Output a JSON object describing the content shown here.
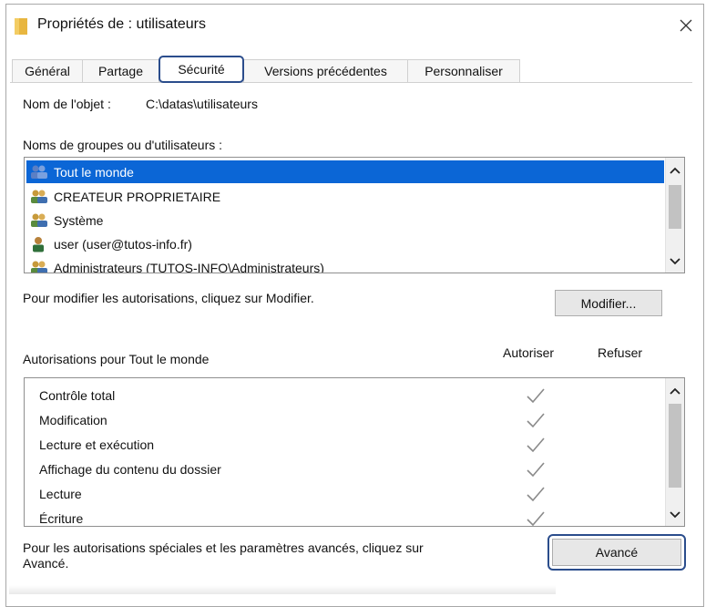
{
  "window": {
    "title": "Propriétés de : utilisateurs"
  },
  "tabs": [
    {
      "label": "Général"
    },
    {
      "label": "Partage"
    },
    {
      "label": "Sécurité"
    },
    {
      "label": "Versions précédentes"
    },
    {
      "label": "Personnaliser"
    }
  ],
  "object": {
    "label": "Nom de l'objet :",
    "value": "C:\\datas\\utilisateurs"
  },
  "groups": {
    "label": "Noms de groupes ou d'utilisateurs :",
    "items": [
      {
        "name": "Tout le monde",
        "selected": true,
        "icon": "group-icon"
      },
      {
        "name": "CREATEUR PROPRIETAIRE",
        "selected": false,
        "icon": "group-icon"
      },
      {
        "name": "Système",
        "selected": false,
        "icon": "group-icon"
      },
      {
        "name": "user (user@tutos-info.fr)",
        "selected": false,
        "icon": "user-icon"
      },
      {
        "name": "Administrateurs (TUTOS-INFO\\Administrateurs)",
        "selected": false,
        "icon": "group-icon"
      }
    ]
  },
  "modify": {
    "hint": "Pour modifier les autorisations, cliquez sur Modifier.",
    "button_label": "Modifier..."
  },
  "permissions": {
    "title": "Autorisations pour Tout le monde",
    "allow_header": "Autoriser",
    "deny_header": "Refuser",
    "items": [
      {
        "name": "Contrôle total",
        "allow": true,
        "deny": false
      },
      {
        "name": "Modification",
        "allow": true,
        "deny": false
      },
      {
        "name": "Lecture et exécution",
        "allow": true,
        "deny": false
      },
      {
        "name": "Affichage du contenu du dossier",
        "allow": true,
        "deny": false
      },
      {
        "name": "Lecture",
        "allow": true,
        "deny": false
      },
      {
        "name": "Écriture",
        "allow": true,
        "deny": false
      }
    ]
  },
  "advanced": {
    "hint_line1": "Pour les autorisations spéciales et les paramètres avancés, cliquez sur",
    "hint_line2": "Avancé.",
    "button_label": "Avancé"
  },
  "colors": {
    "selection": "#0b66d6",
    "focus_border": "#2b4d8c",
    "folder": "#e8b640"
  }
}
